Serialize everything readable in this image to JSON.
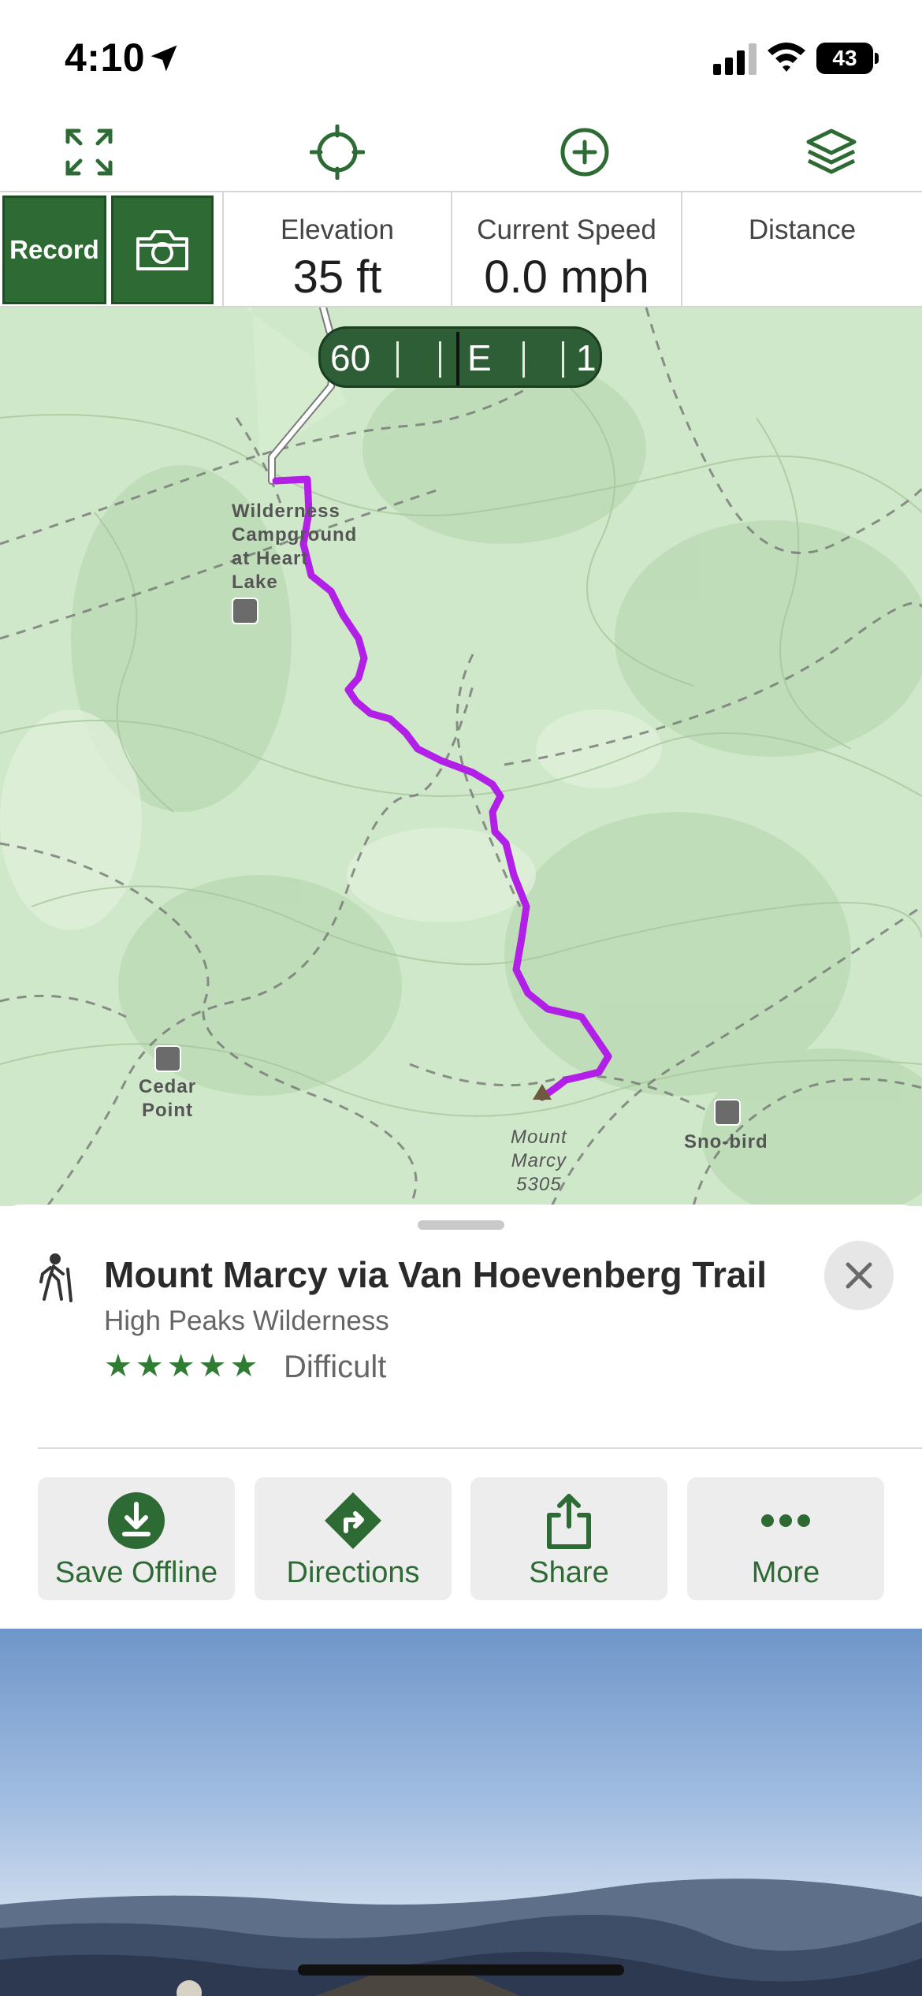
{
  "status_bar": {
    "time": "4:10",
    "battery": "43"
  },
  "toolbar": {
    "icons": [
      "expand-icon",
      "locate-icon",
      "add-icon",
      "layers-icon"
    ]
  },
  "stats": {
    "record_label": "Record",
    "elevation_label": "Elevation",
    "elevation_value": "35 ft",
    "speed_label": "Current Speed",
    "speed_value": "0.0 mph",
    "distance_label": "Distance",
    "distance_value": ""
  },
  "map": {
    "compass": {
      "left": "60",
      "heading": "E",
      "right": "1"
    },
    "labels": {
      "campground": [
        "Wilderness",
        "Campground",
        "at Heart",
        "Lake"
      ],
      "cedar_point": [
        "Cedar",
        "Point"
      ],
      "mount_marcy": [
        "Mount",
        "Marcy",
        "5305"
      ],
      "sno_bird": "Sno-bird"
    },
    "colors": {
      "trail": "#b21fe6",
      "terrain": "#cfe8c9",
      "road": "#ffffff"
    }
  },
  "trail": {
    "name": "Mount Marcy via Van Hoevenberg Trail",
    "region": "High Peaks Wilderness",
    "stars": "★★★★★",
    "difficulty": "Difficult"
  },
  "actions": [
    {
      "label": "Save Offline",
      "icon": "download-icon"
    },
    {
      "label": "Directions",
      "icon": "directions-icon"
    },
    {
      "label": "Share",
      "icon": "share-icon"
    },
    {
      "label": "More",
      "icon": "more-icon"
    }
  ],
  "colors": {
    "accent": "#2e6b34",
    "accent_dark": "#1f4d24"
  }
}
